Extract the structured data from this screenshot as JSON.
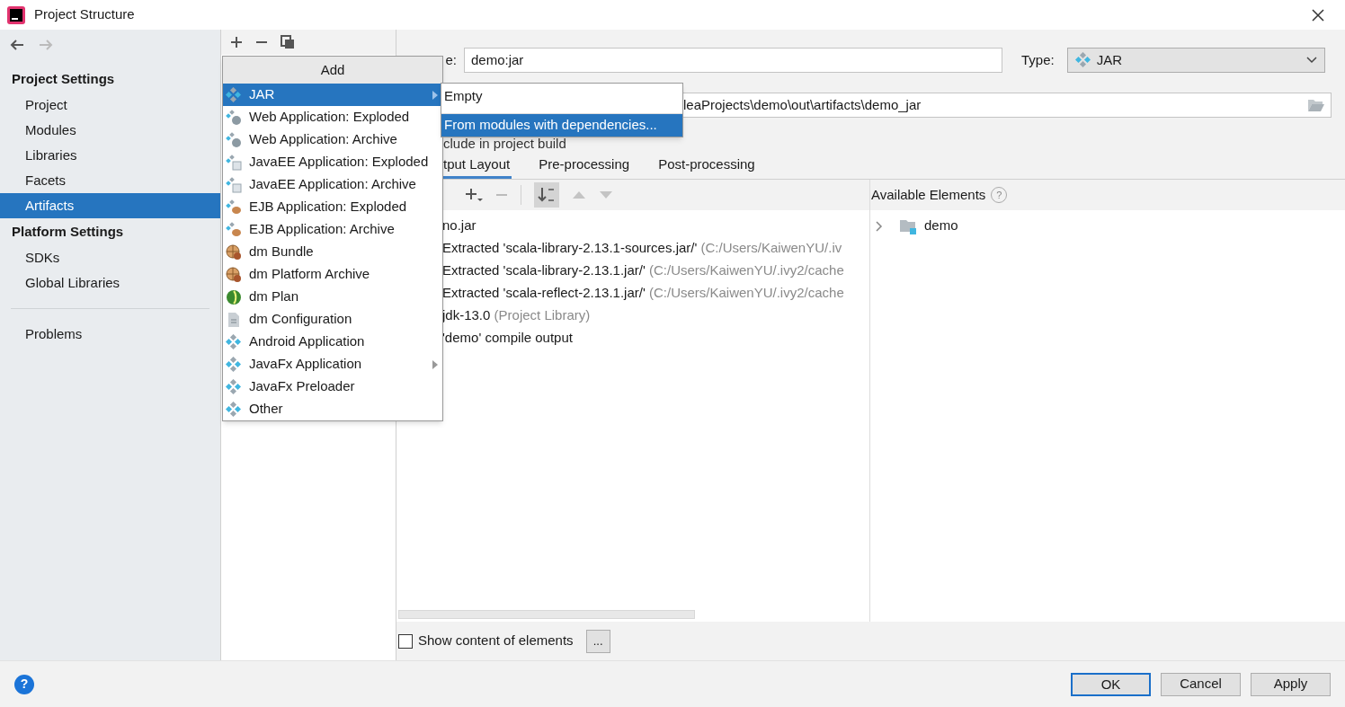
{
  "window": {
    "title": "Project Structure"
  },
  "sidebar": {
    "sections": [
      {
        "title": "Project Settings",
        "items": [
          {
            "label": "Project",
            "selected": false
          },
          {
            "label": "Modules",
            "selected": false
          },
          {
            "label": "Libraries",
            "selected": false
          },
          {
            "label": "Facets",
            "selected": false
          },
          {
            "label": "Artifacts",
            "selected": true
          }
        ]
      },
      {
        "title": "Platform Settings",
        "items": [
          {
            "label": "SDKs",
            "selected": false
          },
          {
            "label": "Global Libraries",
            "selected": false
          }
        ]
      }
    ],
    "footer_items": [
      {
        "label": "Problems",
        "selected": false
      }
    ]
  },
  "add_menu": {
    "title": "Add",
    "items": [
      {
        "label": "JAR",
        "selected": true,
        "submenu": true,
        "kind": "jar"
      },
      {
        "label": "Web Application: Exploded",
        "selected": false,
        "submenu": false,
        "kind": "web"
      },
      {
        "label": "Web Application: Archive",
        "selected": false,
        "submenu": false,
        "kind": "web"
      },
      {
        "label": "JavaEE Application: Exploded",
        "selected": false,
        "submenu": false,
        "kind": "javaee"
      },
      {
        "label": "JavaEE Application: Archive",
        "selected": false,
        "submenu": false,
        "kind": "javaee"
      },
      {
        "label": "EJB Application: Exploded",
        "selected": false,
        "submenu": false,
        "kind": "ejb"
      },
      {
        "label": "EJB Application: Archive",
        "selected": false,
        "submenu": false,
        "kind": "ejb"
      },
      {
        "label": "dm Bundle",
        "selected": false,
        "submenu": false,
        "kind": "bundle"
      },
      {
        "label": "dm Platform Archive",
        "selected": false,
        "submenu": false,
        "kind": "bundle"
      },
      {
        "label": "dm Plan",
        "selected": false,
        "submenu": false,
        "kind": "plan"
      },
      {
        "label": "dm Configuration",
        "selected": false,
        "submenu": false,
        "kind": "file"
      },
      {
        "label": "Android Application",
        "selected": false,
        "submenu": false,
        "kind": "jar"
      },
      {
        "label": "JavaFx Application",
        "selected": false,
        "submenu": true,
        "kind": "jar"
      },
      {
        "label": "JavaFx Preloader",
        "selected": false,
        "submenu": false,
        "kind": "jar"
      },
      {
        "label": "Other",
        "selected": false,
        "submenu": false,
        "kind": "jar"
      }
    ]
  },
  "jar_submenu": {
    "items": [
      {
        "label": "Empty",
        "selected": false
      },
      {
        "label": "From modules with dependencies...",
        "selected": true
      }
    ]
  },
  "artifact": {
    "name_label": "e:",
    "name_value": "demo:jar",
    "type_label": "Type:",
    "type_value": "JAR",
    "output_dir_value": "leaProjects\\demo\\out\\artifacts\\demo_jar",
    "include_label": "clude in project build"
  },
  "tabs": [
    {
      "label": "tput Layout",
      "selected": true
    },
    {
      "label": "Pre-processing",
      "selected": false
    },
    {
      "label": "Post-processing",
      "selected": false
    }
  ],
  "layout_tree": [
    {
      "label": "no.jar"
    },
    {
      "label": "Extracted 'scala-library-2.13.1-sources.jar/'",
      "detail": "(C:/Users/KaiwenYU/.iv"
    },
    {
      "label": "Extracted 'scala-library-2.13.1.jar/'",
      "detail": "(C:/Users/KaiwenYU/.ivy2/cache"
    },
    {
      "label": "Extracted 'scala-reflect-2.13.1.jar/'",
      "detail": "(C:/Users/KaiwenYU/.ivy2/cache"
    },
    {
      "label": "jdk-13.0",
      "detail": "(Project Library)"
    },
    {
      "label": "'demo' compile output"
    }
  ],
  "available": {
    "title": "Available Elements",
    "help": "?",
    "items": [
      {
        "label": "demo",
        "expanded": false
      }
    ]
  },
  "help_button": "?",
  "show_content": {
    "label": "Show content of elements",
    "checked": false,
    "more": "..."
  },
  "buttons": [
    {
      "label": "OK",
      "default": true
    },
    {
      "label": "Cancel",
      "default": false
    },
    {
      "label": "Apply",
      "default": false
    }
  ]
}
